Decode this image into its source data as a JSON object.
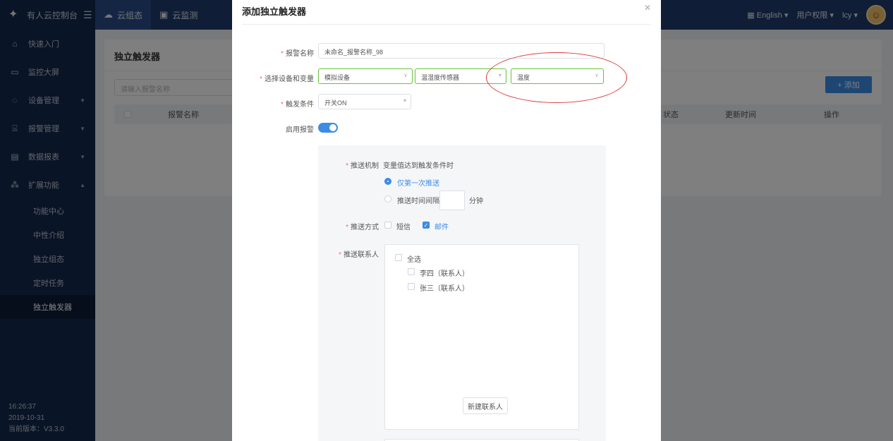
{
  "topbar": {
    "brand": "有人云控制台",
    "tabs": [
      {
        "label": "云组态"
      },
      {
        "label": "云监测"
      }
    ],
    "language": "English",
    "user_permissions": "用户权限",
    "username": "lcy"
  },
  "sidebar": {
    "items": [
      {
        "label": "快速入门"
      },
      {
        "label": "监控大屏"
      },
      {
        "label": "设备管理"
      },
      {
        "label": "报警管理"
      },
      {
        "label": "数据报表"
      },
      {
        "label": "扩展功能"
      }
    ],
    "subitems": [
      {
        "label": "功能中心"
      },
      {
        "label": "中性介绍"
      },
      {
        "label": "独立组态"
      },
      {
        "label": "定时任务"
      },
      {
        "label": "独立触发器"
      }
    ],
    "time": "16:26:37",
    "date": "2019-10-31",
    "version": "当前版本：V3.3.0"
  },
  "page": {
    "title": "独立触发器",
    "search_placeholder": "请输入报警名称",
    "add_button": "+ 添加",
    "columns": [
      "报警名称",
      "状态",
      "更新时间",
      "操作"
    ]
  },
  "dialog": {
    "title": "添加独立触发器",
    "fields": {
      "alarm_name_label": "报警名称",
      "alarm_name_value": "未命名_报警名称_98",
      "device_var_label": "选择设备和变量",
      "device_value": "模拟设备",
      "sensor_value": "温湿度传感器",
      "variable_value": "温度",
      "trigger_label": "触发条件",
      "trigger_value": "开关ON",
      "enable_label": "启用报警"
    },
    "push": {
      "mechanism_label": "推送机制",
      "mechanism_desc": "变量值达到触发条件时",
      "option_first": "仅第一次推送",
      "option_interval": "推送时间间隔",
      "interval_unit": "分钟",
      "method_label": "推送方式",
      "method_sms": "短信",
      "method_email": "邮件",
      "contacts_label": "推送联系人",
      "select_all": "全选",
      "contacts": [
        "李四（联系人）",
        "张三（联系人）"
      ],
      "new_contact": "新建联系人"
    }
  }
}
